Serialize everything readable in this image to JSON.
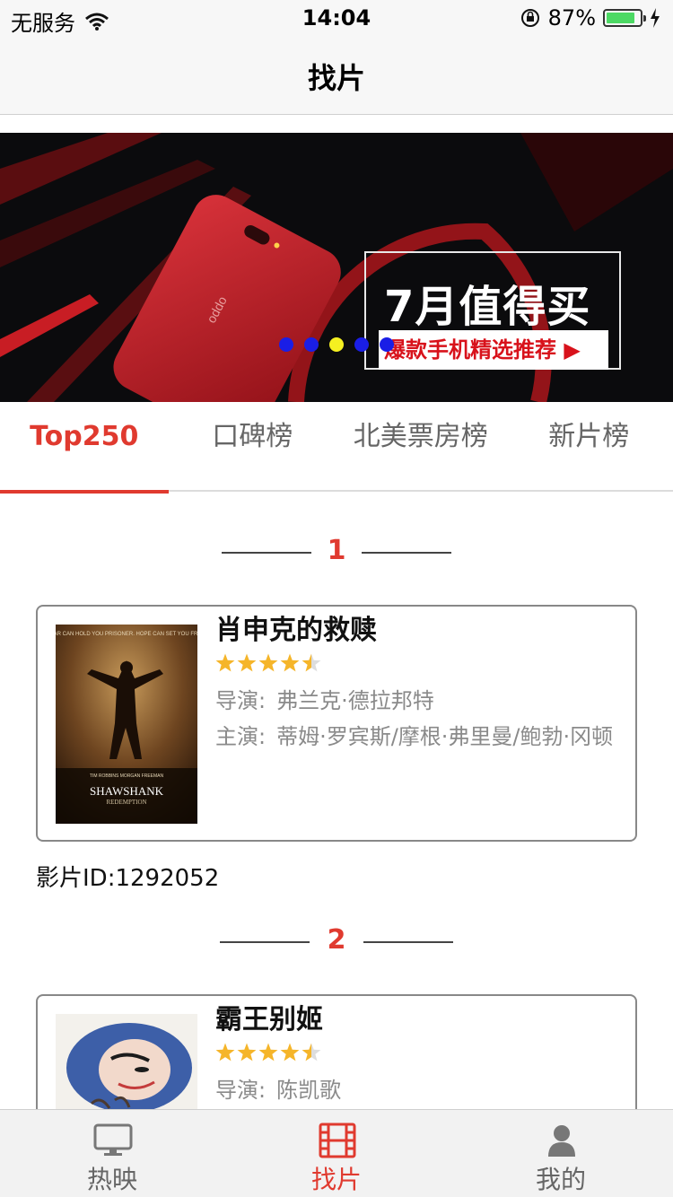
{
  "status_bar": {
    "carrier": "无服务",
    "time": "14:04",
    "battery_percent": "87%",
    "battery_level": 0.87
  },
  "nav": {
    "title": "找片"
  },
  "banner": {
    "headline": "7月值得买",
    "subline": "爆款手机精选推荐",
    "phone_brand": "oppo",
    "dots_count": 5,
    "active_dot": 2
  },
  "tabs": [
    {
      "label": "Top250",
      "active": true
    },
    {
      "label": "口碑榜",
      "active": false
    },
    {
      "label": "北美票房榜",
      "active": false
    },
    {
      "label": "新片榜",
      "active": false
    }
  ],
  "movies": [
    {
      "rank": "1",
      "title": "肖申克的救赎",
      "rating_stars": 4.5,
      "director_label": "导演:",
      "director": "弗兰克·德拉邦特",
      "cast_label": "主演:",
      "cast": "蒂姆·罗宾斯/摩根·弗里曼/鲍勃·冈顿",
      "id_text": "影片ID:1292052",
      "poster_text": {
        "title": "SHAWSHANK",
        "subtitle": "REDEMPTION",
        "tagline": "FEAR CAN HOLD YOU PRISONER. HOPE CAN SET YOU FREE.",
        "credits": "TIM ROBBINS   MORGAN FREEMAN"
      }
    },
    {
      "rank": "2",
      "title": "霸王别姬",
      "rating_stars": 4.5,
      "director_label": "导演:",
      "director": "陈凯歌"
    }
  ],
  "tab_bar": [
    {
      "label": "热映",
      "icon": "tv-icon",
      "active": false
    },
    {
      "label": "找片",
      "icon": "film-icon",
      "active": true
    },
    {
      "label": "我的",
      "icon": "user-icon",
      "active": false
    }
  ],
  "colors": {
    "accent": "#e03a2f",
    "star": "#f5b52a",
    "banner_dot": "#1a1ee6",
    "banner_dot_active": "#f5f021"
  }
}
